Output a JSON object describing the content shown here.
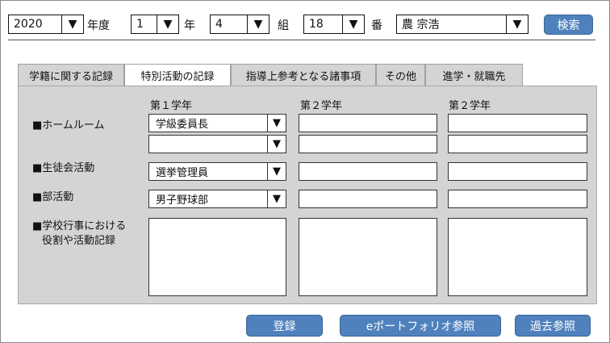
{
  "header": {
    "year": "2020",
    "year_suffix": "年度",
    "grade": "1",
    "grade_suffix": "年",
    "class": "4",
    "class_suffix": "組",
    "number": "18",
    "number_suffix": "番",
    "student": "農 宗浩",
    "search_label": "検索",
    "dropdown_arrow": "▼"
  },
  "tabs": [
    {
      "label": "学籍に関する記録",
      "active": false
    },
    {
      "label": "特別活動の記録",
      "active": true
    },
    {
      "label": "指導上参考となる諸事項",
      "active": false
    },
    {
      "label": "その他",
      "active": false
    },
    {
      "label": "進学・就職先",
      "active": false
    }
  ],
  "columns": [
    "第１学年",
    "第２学年",
    "第２学年"
  ],
  "rows": {
    "homeroom": "■ホームルーム",
    "student_council": "■生徒会活動",
    "club": "■部活動",
    "school_events_line1": "■学校行事における",
    "school_events_line2": "役割や活動記録"
  },
  "values": {
    "homeroom_1": "学級委員長",
    "homeroom_2": "",
    "student_council": "選挙管理員",
    "club": "男子野球部"
  },
  "footer": {
    "register_label": "登録",
    "portfolio_label": "eポートフォリオ参照",
    "history_label": "過去参照"
  }
}
